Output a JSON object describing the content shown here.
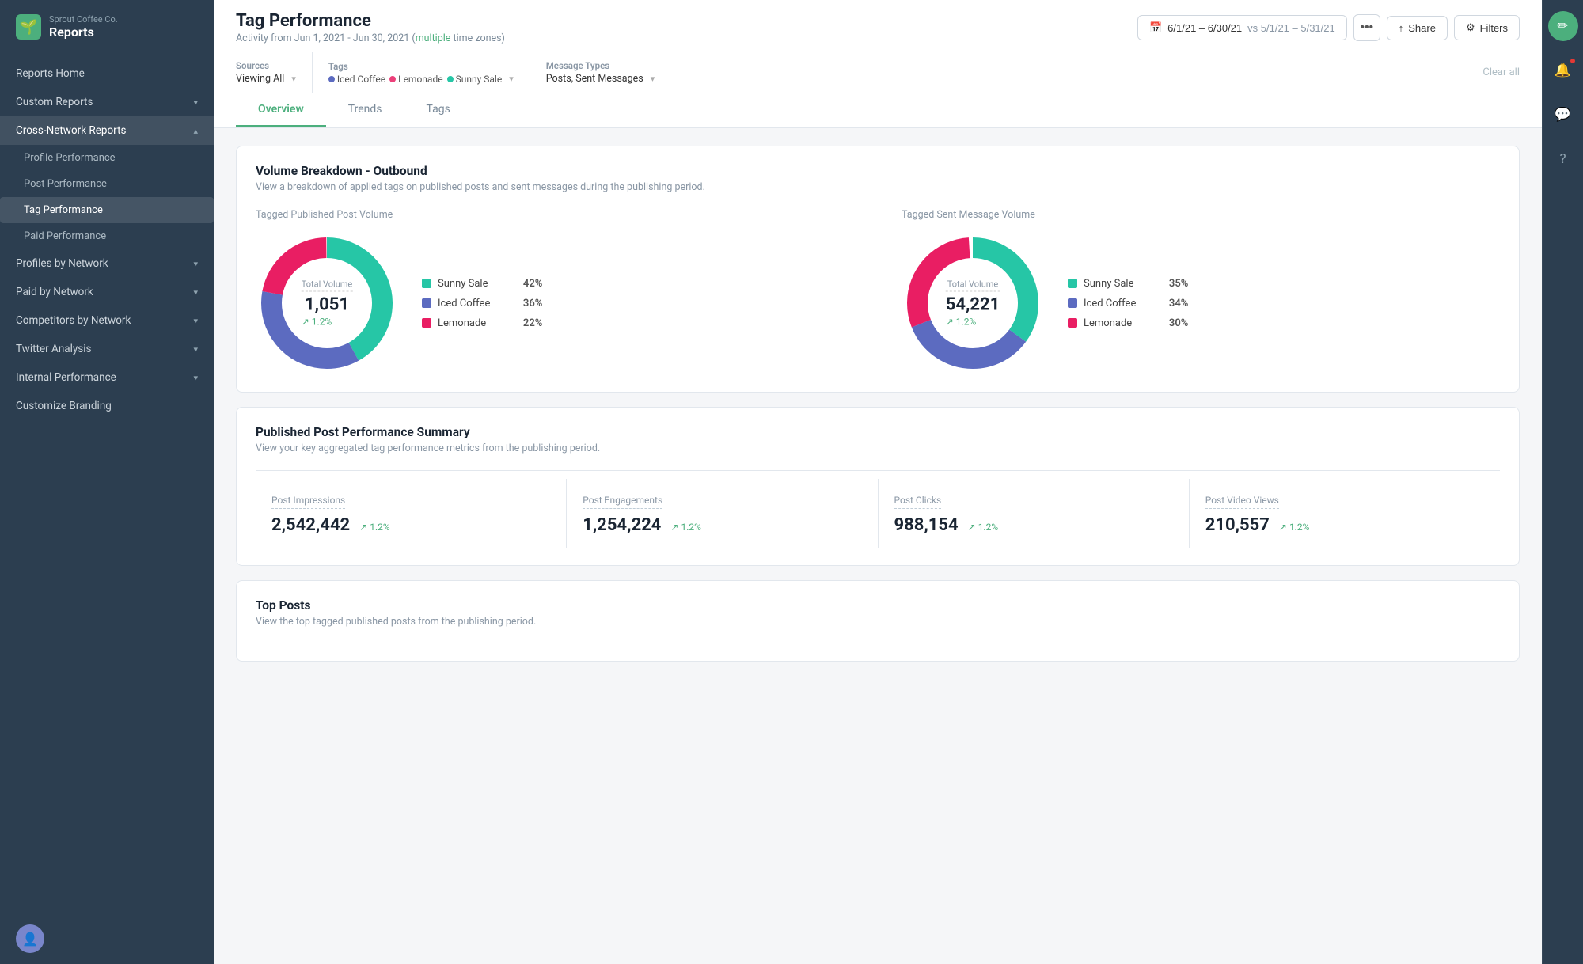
{
  "sidebar": {
    "company": "Sprout Coffee Co.",
    "section": "Reports",
    "nav": [
      {
        "id": "reports-home",
        "label": "Reports Home",
        "type": "item"
      },
      {
        "id": "custom-reports",
        "label": "Custom Reports",
        "type": "group",
        "expanded": false
      },
      {
        "id": "cross-network-reports",
        "label": "Cross-Network Reports",
        "type": "group",
        "expanded": true,
        "children": [
          {
            "id": "profile-performance",
            "label": "Profile Performance"
          },
          {
            "id": "post-performance",
            "label": "Post Performance"
          },
          {
            "id": "tag-performance",
            "label": "Tag Performance",
            "active": true
          },
          {
            "id": "paid-performance",
            "label": "Paid Performance"
          }
        ]
      },
      {
        "id": "profiles-by-network",
        "label": "Profiles by Network",
        "type": "group",
        "expanded": false
      },
      {
        "id": "paid-by-network",
        "label": "Paid by Network",
        "type": "group",
        "expanded": false
      },
      {
        "id": "competitors-by-network",
        "label": "Competitors by Network",
        "type": "group",
        "expanded": false
      },
      {
        "id": "twitter-analysis",
        "label": "Twitter Analysis",
        "type": "group",
        "expanded": false
      },
      {
        "id": "internal-performance",
        "label": "Internal Performance",
        "type": "group",
        "expanded": false
      },
      {
        "id": "customize-branding",
        "label": "Customize Branding",
        "type": "item"
      }
    ]
  },
  "header": {
    "title": "Tag Performance",
    "subtitle": "Activity from Jun 1, 2021 - Jun 30, 2021",
    "subtitle_link": "multiple",
    "subtitle_suffix": " time zones)",
    "date_range": "6/1/21 – 6/30/21",
    "compare_range": "vs 5/1/21 – 5/31/21",
    "share_label": "Share",
    "filters_label": "Filters"
  },
  "filters": {
    "sources_label": "Sources",
    "sources_value": "Viewing All",
    "tags_label": "Tags",
    "tags": [
      {
        "name": "Iced Coffee",
        "color": "#5c6bc0"
      },
      {
        "name": "Lemonade",
        "color": "#ec407a"
      },
      {
        "name": "Sunny Sale",
        "color": "#26c6a6"
      }
    ],
    "message_types_label": "Message Types",
    "message_types_value": "Posts, Sent Messages",
    "clear_all": "Clear all"
  },
  "tabs": [
    {
      "id": "overview",
      "label": "Overview",
      "active": true
    },
    {
      "id": "trends",
      "label": "Trends",
      "active": false
    },
    {
      "id": "tags",
      "label": "Tags",
      "active": false
    }
  ],
  "volume_breakdown": {
    "title": "Volume Breakdown - Outbound",
    "subtitle": "View a breakdown of applied tags on published posts and sent messages during the publishing period.",
    "published_label": "Tagged Published Post Volume",
    "sent_label": "Tagged Sent Message Volume",
    "published": {
      "center_label": "Total Volume",
      "center_value": "1,051",
      "center_change": "1.2%",
      "segments": [
        {
          "label": "Sunny Sale",
          "color": "#26c6a6",
          "pct": 42,
          "deg": 151
        },
        {
          "label": "Iced Coffee",
          "color": "#5c6bc0",
          "pct": 36,
          "deg": 130
        },
        {
          "label": "Lemonade",
          "color": "#e91e63",
          "pct": 22,
          "deg": 79
        }
      ]
    },
    "sent": {
      "center_label": "Total Volume",
      "center_value": "54,221",
      "center_change": "1.2%",
      "segments": [
        {
          "label": "Sunny Sale",
          "color": "#26c6a6",
          "pct": 35,
          "deg": 126
        },
        {
          "label": "Iced Coffee",
          "color": "#5c6bc0",
          "pct": 34,
          "deg": 122
        },
        {
          "label": "Lemonade",
          "color": "#e91e63",
          "pct": 30,
          "deg": 108
        }
      ]
    }
  },
  "post_performance": {
    "title": "Published Post Performance Summary",
    "subtitle": "View your key aggregated tag performance metrics from the publishing period.",
    "metrics": [
      {
        "name": "Post Impressions",
        "value": "2,542,442",
        "change": "1.2%"
      },
      {
        "name": "Post Engagements",
        "value": "1,254,224",
        "change": "1.2%"
      },
      {
        "name": "Post Clicks",
        "value": "988,154",
        "change": "1.2%"
      },
      {
        "name": "Post Video Views",
        "value": "210,557",
        "change": "1.2%"
      }
    ]
  },
  "top_posts": {
    "title": "Top Posts",
    "subtitle": "View the top tagged published posts from the publishing period."
  }
}
